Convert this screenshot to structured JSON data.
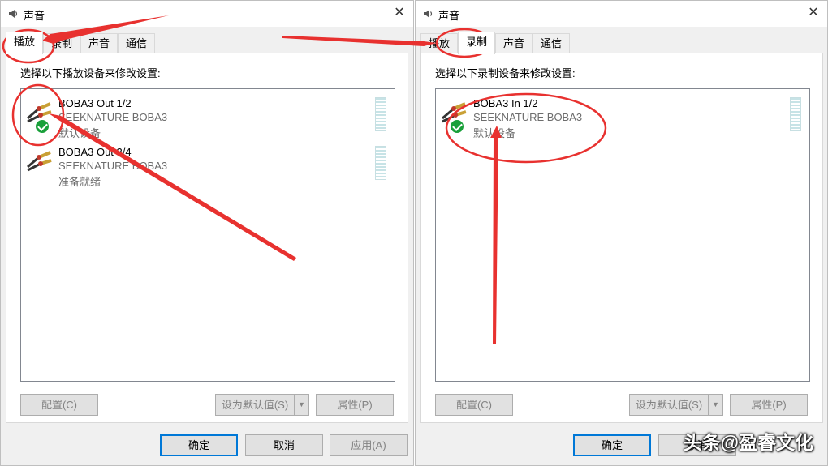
{
  "left_window": {
    "title": "声音",
    "close_glyph": "✕",
    "tabs": [
      {
        "label": "播放",
        "active": true
      },
      {
        "label": "录制",
        "active": false
      },
      {
        "label": "声音",
        "active": false
      },
      {
        "label": "通信",
        "active": false
      }
    ],
    "instruction": "选择以下播放设备来修改设置:",
    "devices": [
      {
        "name": "BOBA3 Out 1/2",
        "subtitle": "SEEKNATURE BOBA3",
        "status": "默认设备",
        "default": true
      },
      {
        "name": "BOBA3 Out 3/4",
        "subtitle": "SEEKNATURE BOBA3",
        "status": "准备就绪",
        "default": false
      }
    ],
    "buttons": {
      "configure": "配置(C)",
      "set_default": "设为默认值(S)",
      "properties": "属性(P)",
      "ok": "确定",
      "cancel": "取消",
      "apply": "应用(A)"
    }
  },
  "right_window": {
    "title": "声音",
    "close_glyph": "✕",
    "tabs": [
      {
        "label": "播放",
        "active": false
      },
      {
        "label": "录制",
        "active": true
      },
      {
        "label": "声音",
        "active": false
      },
      {
        "label": "通信",
        "active": false
      }
    ],
    "instruction": "选择以下录制设备来修改设置:",
    "devices": [
      {
        "name": "BOBA3 In 1/2",
        "subtitle": "SEEKNATURE BOBA3",
        "status": "默认设备",
        "default": true
      }
    ],
    "buttons": {
      "configure": "配置(C)",
      "set_default": "设为默认值(S)",
      "properties": "属性(P)",
      "ok": "确定",
      "cancel": "取消"
    }
  },
  "watermark": "头条@盈睿文化",
  "colors": {
    "annotation_red": "#e8312f",
    "check_green": "#19a03a",
    "focus_blue": "#0078d7"
  },
  "icons": {
    "title": "speaker-icon",
    "device": "rca-cable-icon",
    "default_badge": "checkmark-badge-icon"
  }
}
